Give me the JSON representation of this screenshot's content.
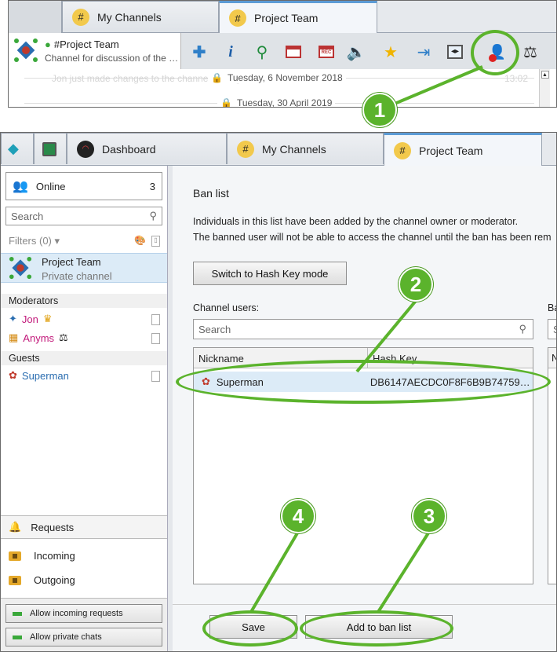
{
  "top": {
    "tabs": [
      {
        "label": "My Channels"
      },
      {
        "label": "Project Team"
      }
    ],
    "channel": {
      "name": "#Project Team",
      "description": "Channel for discussion of the …"
    },
    "toolbar_icons": [
      "add-icon",
      "info-icon",
      "search-icon",
      "channel-window-icon",
      "record-icon",
      "speaker-icon",
      "star-icon",
      "exit-icon",
      "code-icon",
      "ban-user-icon",
      "scales-icon"
    ],
    "timeline": [
      {
        "text": "Tuesday, 6 November 2018"
      },
      {
        "text": "Tuesday, 30 April 2019"
      }
    ],
    "faded_message": "Jon just made changes to the channel settings",
    "faded_time": "13:02"
  },
  "main": {
    "tabs": [
      {
        "label": ""
      },
      {
        "label": ""
      },
      {
        "label": "Dashboard"
      },
      {
        "label": "My Channels"
      },
      {
        "label": "Project Team"
      }
    ],
    "sidebar": {
      "online_label": "Online",
      "online_count": "3",
      "search_placeholder": "Search",
      "filters_label": "Filters (0) ▾",
      "channel_name": "Project Team",
      "channel_type": "Private channel",
      "moderators_heading": "Moderators",
      "moderators": [
        {
          "name": "Jon",
          "badge": "♛"
        },
        {
          "name": "Anyms",
          "badge": "⚖"
        }
      ],
      "guests_heading": "Guests",
      "guests": [
        {
          "name": "Superman"
        }
      ],
      "requests_label": "Requests",
      "incoming_label": "Incoming",
      "outgoing_label": "Outgoing",
      "allow_incoming_label": "Allow incoming requests",
      "allow_private_label": "Allow private chats"
    },
    "ban": {
      "title": "Ban list",
      "line1": "Individuals in this list have been added by the channel owner or moderator.",
      "line2": "The banned user will not be able to access the channel until the ban has been rem",
      "hash_mode_button": "Switch to Hash Key mode",
      "channel_users_label": "Channel users:",
      "right_col_label": "Ba",
      "search_placeholder": "Search",
      "right_search_placeholder": "S",
      "col_nickname": "Nickname",
      "col_hashkey": "Hash Key",
      "right_col_header": "N",
      "users": [
        {
          "nickname": "Superman",
          "hash": "DB6147AECDC0F8F6B9B74759…"
        }
      ],
      "save_button": "Save",
      "add_button": "Add to ban list"
    }
  },
  "callouts": [
    "1",
    "2",
    "3",
    "4"
  ],
  "colors": {
    "accent_green": "#5bb32c",
    "tab_accent": "#5b9bd5",
    "selection": "#dcebf7"
  }
}
